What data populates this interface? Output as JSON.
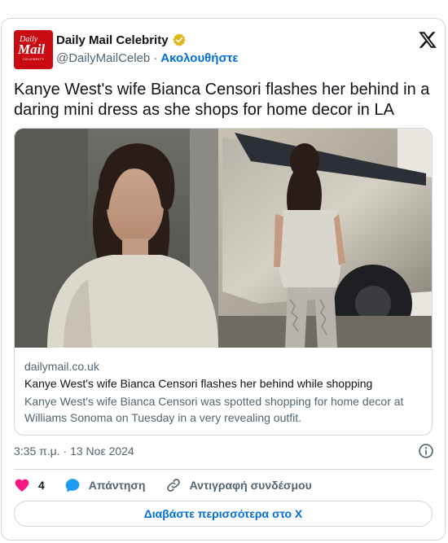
{
  "author": {
    "name": "Daily Mail Celebrity",
    "handle": "@DailyMailCeleb",
    "follow_label": "Ακολουθήστε",
    "logo_line1": "Daily",
    "logo_line2": "Mail",
    "logo_line3": "CELEBRITY"
  },
  "tweet": {
    "text": "Kanye West's wife Bianca Censori flashes her behind in a daring mini dress as she shops for home decor in LA",
    "timestamp": "3:35 π.μ. · 13 Νοε 2024"
  },
  "link_card": {
    "domain": "dailymail.co.uk",
    "title": "Kanye West's wife Bianca Censori flashes her behind while shopping",
    "description": "Kanye West's wife Bianca Censori was spotted shopping for home decor at Williams Sonoma on Tuesday in a very revealing outfit."
  },
  "actions": {
    "like_count": "4",
    "reply_label": "Απάντηση",
    "copy_link_label": "Αντιγραφή συνδέσμου"
  },
  "read_more_label": "Διαβάστε περισσότερα στο X",
  "colors": {
    "accent": "#006fd6",
    "like": "#f91880",
    "brand_red": "#c90a10",
    "verified_gold": "#e2b719",
    "reply_blue": "#1d9bf0",
    "muted": "#536471"
  },
  "icons": {
    "verified": "verified-badge-icon",
    "x_logo": "x-logo-icon",
    "info": "info-icon",
    "like": "heart-icon",
    "reply": "speech-bubble-icon",
    "copy_link": "link-icon"
  }
}
